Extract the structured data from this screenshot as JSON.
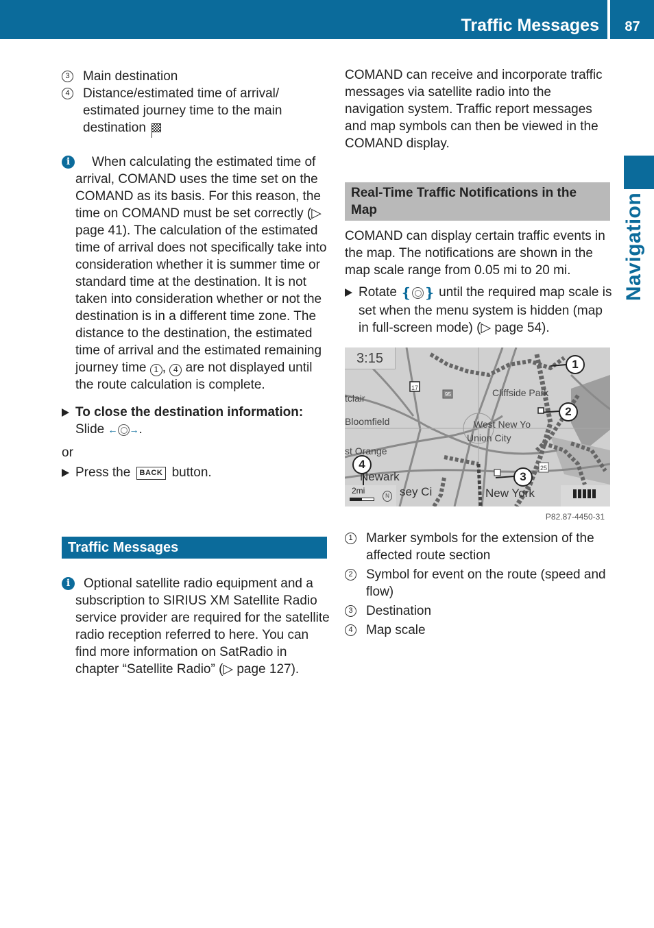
{
  "header": {
    "title": "Traffic Messages",
    "page_number": "87"
  },
  "side_tab": {
    "label": "Navigation"
  },
  "colors": {
    "brand_blue": "#0b6b9b",
    "section_gray": "#b9b9b9"
  },
  "left_column": {
    "legend": [
      {
        "num": "3",
        "text": "Main destination"
      },
      {
        "num": "4",
        "text": "Distance/estimated time of arrival/ estimated journey time to the main destination",
        "icon": "checkered-flag-icon"
      }
    ],
    "info_note": {
      "icon": "info-icon",
      "text_before": "When calculating the estimated time of arrival, COMAND uses the time set on the COMAND as its basis. For this reason, the time on COMAND must be set correctly (",
      "page_ref_symbol": "▷",
      "page_ref": "page 41",
      "text_after": "). The calculation of the estimated time of arrival does not specifically take into consideration whether it is summer time or standard time at the destination. It is not taken into consideration whether or not the destination is in a different time zone. The distance to the destination, the estimated time of arrival and the estimated remaining journey time ",
      "ref1": "1",
      "ref_sep": ", ",
      "ref2": "4",
      "text_end": " are not displayed until the route calculation is complete."
    },
    "step_close": {
      "heading": "To close the destination information:",
      "text": "Slide",
      "icon": "slide-controller-icon",
      "end": "."
    },
    "or_text": "or",
    "step_back": {
      "text_before": "Press the",
      "key": "BACK",
      "text_after": "button."
    },
    "section_title": "Traffic Messages",
    "info_note2": {
      "icon": "info-icon",
      "text_before": "Optional satellite radio equipment and a subscription to SIRIUS XM Satellite Radio service provider are required for the satellite radio reception referred to here. You can find more information on SatRadio in chapter “Satellite Radio” (",
      "page_ref_symbol": "▷",
      "page_ref": "page 127",
      "text_after": ")."
    }
  },
  "right_column": {
    "intro": "COMAND can receive and incorporate traffic messages via satellite radio into the navigation system. Traffic report messages and map symbols can then be viewed in the COMAND display.",
    "section_title": "Real-Time Traffic Notifications in the Map",
    "body": "COMAND can display certain traffic events in the map. The notifications are shown in the map scale range from 0.05 mi to 20 mi.",
    "step_rotate": {
      "text_before": "Rotate",
      "icon": "rotate-controller-icon",
      "text_after": "until the required map scale is set when the menu system is hidden (map in full-screen mode) (",
      "page_ref_symbol": "▷",
      "page_ref": "page 54",
      "text_end": ")."
    },
    "map": {
      "time": "3:15",
      "labels": {
        "montclair": "tclair",
        "bloomfield": "Bloomfield",
        "east_orange": "st Orange",
        "newark": "Newark",
        "jersey_city": "sey Ci",
        "new_york": "New York",
        "cliffside_park": "Cliffside Park",
        "west_new_york": "West New Yo",
        "union_city": "Union City",
        "route_17": "17",
        "route_95": "95",
        "route_25": "25"
      },
      "scale": "2mi",
      "compass": "N",
      "callouts": [
        "1",
        "2",
        "3",
        "4"
      ]
    },
    "figure_id": "P82.87-4450-31",
    "legend": [
      {
        "num": "1",
        "text": "Marker symbols for the extension of the affected route section"
      },
      {
        "num": "2",
        "text": "Symbol for event on the route (speed and flow)"
      },
      {
        "num": "3",
        "text": "Destination"
      },
      {
        "num": "4",
        "text": "Map scale"
      }
    ]
  }
}
